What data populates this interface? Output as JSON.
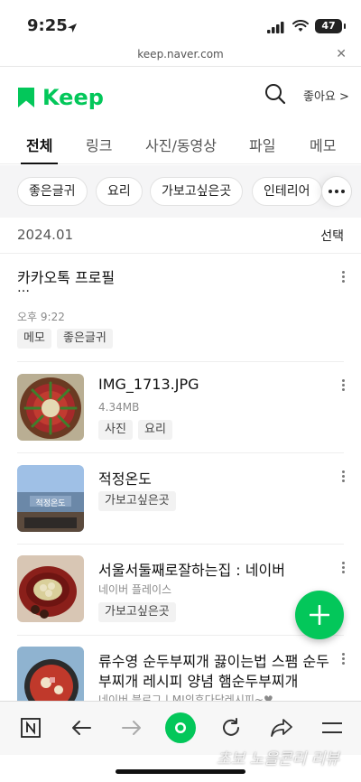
{
  "status": {
    "time": "9:25",
    "battery": "47"
  },
  "browser": {
    "url": "keep.naver.com"
  },
  "header": {
    "app_name": "Keep",
    "likes_label": "좋아요 >"
  },
  "tabs": [
    {
      "label": "전체",
      "active": true
    },
    {
      "label": "링크"
    },
    {
      "label": "사진/동영상"
    },
    {
      "label": "파일"
    },
    {
      "label": "메모"
    }
  ],
  "tag_filters": [
    "좋은글귀",
    "요리",
    "가보고싶은곳",
    "인테리어"
  ],
  "section": {
    "date": "2024.01",
    "select_label": "선택"
  },
  "items": [
    {
      "title": "카카오톡 프로필",
      "snippet": "…",
      "time": "오후 9:22",
      "tags": [
        "메모",
        "좋은글귀"
      ]
    },
    {
      "title": "IMG_1713.JPG",
      "meta": "4.34MB",
      "tags": [
        "사진",
        "요리"
      ]
    },
    {
      "title": "적정온도",
      "tags": [
        "가보고싶은곳"
      ],
      "thumb_sign": "적정온도"
    },
    {
      "title": "서울서둘째로잘하는집 : 네이버",
      "meta": "네이버 플레이스",
      "tags": [
        "가보고싶은곳"
      ]
    },
    {
      "title_line1": "류수영 순두부찌개 끓이는법 스팸 순두",
      "title_line2": "부찌개 레시피 양념 햄순두부찌개",
      "meta": "네이버 블로그 | MJ의후다닥레시피~♥"
    }
  ],
  "watermark": "초보 노을콘리 리뷰",
  "colors": {
    "brand": "#03c75a"
  }
}
